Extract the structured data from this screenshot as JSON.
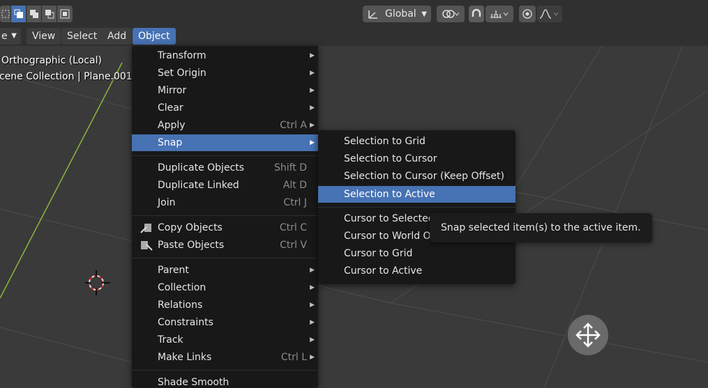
{
  "header": {
    "orientation_value": "Global",
    "pivot_icon": "dropdown-pivot",
    "snap_icon": "magnet-icon",
    "proportional_icon": "proportional-edit-icon"
  },
  "menubar": {
    "mode_partial": "e",
    "view": "View",
    "select": "Select",
    "add": "Add",
    "object": "Object"
  },
  "viewport": {
    "view_name": "Orthographic (Local)",
    "collection_info": "cene Collection | Plane.001"
  },
  "object_menu": {
    "items": [
      {
        "label": "Transform",
        "submenu": true
      },
      {
        "label": "Set Origin",
        "submenu": true
      },
      {
        "label": "Mirror",
        "submenu": true
      },
      {
        "label": "Clear",
        "submenu": true
      },
      {
        "label": "Apply",
        "shortcut": "Ctrl A",
        "submenu": true
      },
      {
        "label": "Snap",
        "submenu": true
      },
      {
        "label": "Duplicate Objects",
        "shortcut": "Shift D"
      },
      {
        "label": "Duplicate Linked",
        "shortcut": "Alt D"
      },
      {
        "label": "Join",
        "shortcut": "Ctrl J"
      },
      {
        "label": "Copy Objects",
        "shortcut": "Ctrl C"
      },
      {
        "label": "Paste Objects",
        "shortcut": "Ctrl V"
      },
      {
        "label": "Parent",
        "submenu": true
      },
      {
        "label": "Collection",
        "submenu": true
      },
      {
        "label": "Relations",
        "submenu": true
      },
      {
        "label": "Constraints",
        "submenu": true
      },
      {
        "label": "Track",
        "submenu": true
      },
      {
        "label": "Make Links",
        "shortcut": "Ctrl L",
        "submenu": true
      },
      {
        "label": "Shade Smooth"
      }
    ]
  },
  "snap_menu": {
    "items": [
      {
        "label": "Selection to Grid"
      },
      {
        "label": "Selection to Cursor"
      },
      {
        "label": "Selection to Cursor (Keep Offset)"
      },
      {
        "label": "Selection to Active"
      },
      {
        "label": "Cursor to Selected"
      },
      {
        "label": "Cursor to World Origin"
      },
      {
        "label": "Cursor to Grid"
      },
      {
        "label": "Cursor to Active"
      }
    ]
  },
  "tooltip": {
    "text": "Snap selected item(s) to the active item."
  },
  "colors": {
    "highlight": "#4772b3",
    "menu_bg": "#181818",
    "viewport_bg": "#3a3a3a",
    "y_axis": "#8cb63c"
  }
}
